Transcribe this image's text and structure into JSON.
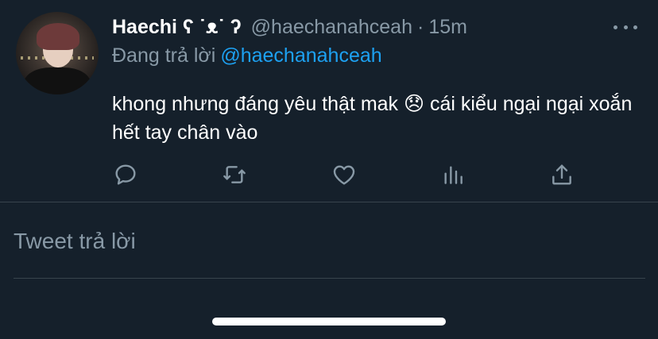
{
  "tweet": {
    "display_name": "Haechi ʕ ˙ᴥ˙ ʔ",
    "handle": "@haechanahceah",
    "separator": "·",
    "time": "15m",
    "reply_prefix": "Đang trả lời",
    "reply_mention": "@haechanahceah",
    "text": "khong nhưng đáng yêu thật mak 😞  cái kiểu ngại ngại xoắn hết tay chân vào",
    "avatar_icon": "user-avatar-photo",
    "more_icon": "more-options-icon",
    "actions": [
      {
        "name": "reply",
        "icon": "reply-icon"
      },
      {
        "name": "retweet",
        "icon": "retweet-icon"
      },
      {
        "name": "like",
        "icon": "heart-icon"
      },
      {
        "name": "analytics",
        "icon": "analytics-icon"
      },
      {
        "name": "share",
        "icon": "share-icon"
      }
    ]
  },
  "reply_box": {
    "placeholder": "Tweet trả lời"
  },
  "colors": {
    "background": "#15202b",
    "secondary_text": "#8899a6",
    "link": "#1da1f2",
    "divider": "#38444d"
  }
}
